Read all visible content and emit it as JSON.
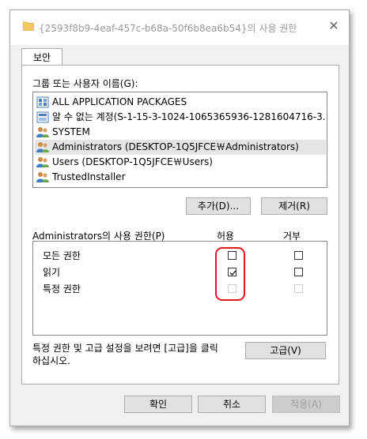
{
  "window": {
    "title": "{2593f8b9-4eaf-457c-b68a-50f6b8ea6b54}의 사용 권한",
    "close_glyph": "✕"
  },
  "tabs": [
    {
      "label": "보안"
    }
  ],
  "group_list": {
    "label": "그룹 또는 사용자 이름(G):",
    "items": [
      {
        "name": "ALL APPLICATION PACKAGES",
        "icon": "package-icon"
      },
      {
        "name": "알 수 없는 계정(S-1-15-3-1024-1065365936-1281604716-3...",
        "icon": "unknown-account-icon"
      },
      {
        "name": "SYSTEM",
        "icon": "users-icon"
      },
      {
        "name": "Administrators (DESKTOP-1Q5JFCE￦Administrators)",
        "icon": "users-icon",
        "selected": true
      },
      {
        "name": "Users (DESKTOP-1Q5JFCE￦Users)",
        "icon": "users-icon"
      },
      {
        "name": "TrustedInstaller",
        "icon": "users-icon"
      }
    ]
  },
  "buttons": {
    "add": "추가(D)...",
    "remove": "제거(R)",
    "advanced": "고급(V)",
    "ok": "확인",
    "cancel": "취소",
    "apply": "적용(A)"
  },
  "permissions": {
    "label": "Administrators의 사용 권한(P)",
    "allow_header": "허용",
    "deny_header": "거부",
    "rows": [
      {
        "name": "모든 권한",
        "allow": false,
        "deny": false,
        "enabled": true
      },
      {
        "name": "읽기",
        "allow": true,
        "deny": false,
        "enabled": true
      },
      {
        "name": "특정 권한",
        "allow": false,
        "deny": false,
        "enabled": false
      }
    ]
  },
  "advanced_note": {
    "line1": "특정 권한 및 고급 설정을 보려면 [고급]을 클릭",
    "line2": "하십시오."
  },
  "colors": {
    "highlight_oval": "#e0191e",
    "selected_row": "#e5e5e5"
  }
}
